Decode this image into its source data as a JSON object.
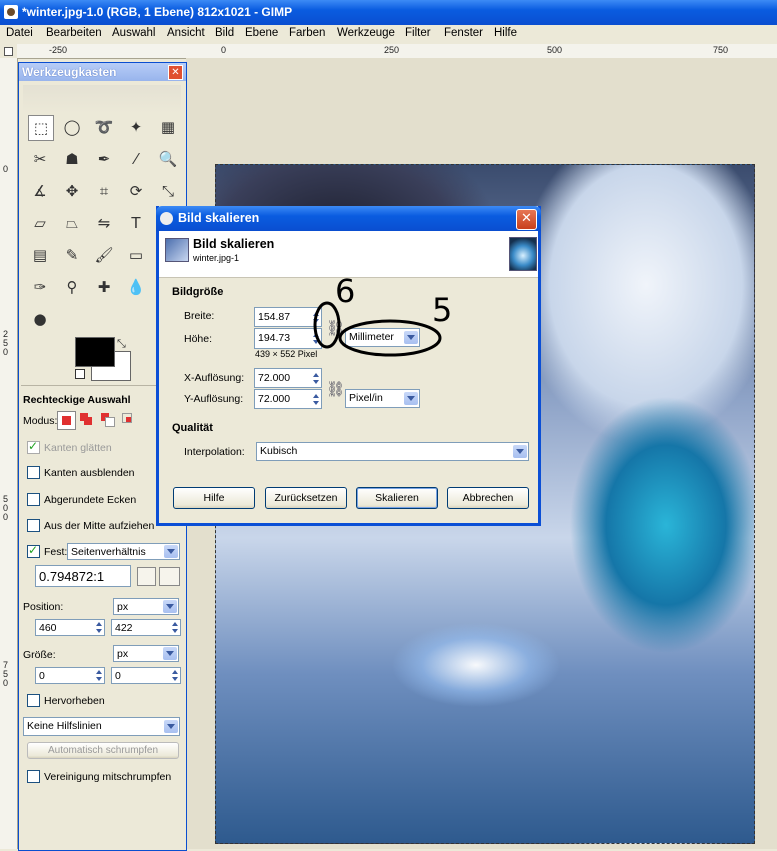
{
  "window": {
    "title": "*winter.jpg-1.0 (RGB, 1 Ebene) 812x1021 - GIMP"
  },
  "menu": [
    "Datei",
    "Bearbeiten",
    "Auswahl",
    "Ansicht",
    "Bild",
    "Ebene",
    "Farben",
    "Werkzeuge",
    "Filter",
    "Fenster",
    "Hilfe"
  ],
  "ruler": {
    "h": [
      "-250",
      "0",
      "250",
      "500",
      "750"
    ],
    "v": [
      "0",
      "2\n5\n0",
      "5\n0\n0",
      "7\n5\n0"
    ]
  },
  "toolbox": {
    "title": "Werkzeugkasten",
    "close": "✕",
    "tools": [
      {
        "name": "rect-select-tool",
        "glyph": "⬚"
      },
      {
        "name": "ellipse-select-tool",
        "glyph": "◯"
      },
      {
        "name": "lasso-tool",
        "glyph": "➰"
      },
      {
        "name": "magic-wand-tool",
        "glyph": "✦"
      },
      {
        "name": "color-select-tool",
        "glyph": "▦"
      },
      {
        "name": "scissors-tool",
        "glyph": "✂"
      },
      {
        "name": "foreground-select-tool",
        "glyph": "☗"
      },
      {
        "name": "paths-tool",
        "glyph": "✒"
      },
      {
        "name": "color-picker-tool",
        "glyph": "⁄"
      },
      {
        "name": "zoom-tool",
        "glyph": "🔍"
      },
      {
        "name": "measure-tool",
        "glyph": "∡"
      },
      {
        "name": "move-tool",
        "glyph": "✥"
      },
      {
        "name": "crop-tool",
        "glyph": "⌗"
      },
      {
        "name": "rotate-tool",
        "glyph": "⟳"
      },
      {
        "name": "scale-tool",
        "glyph": "⤡"
      },
      {
        "name": "shear-tool",
        "glyph": "▱"
      },
      {
        "name": "perspective-tool",
        "glyph": "⏢"
      },
      {
        "name": "flip-tool",
        "glyph": "⇋"
      },
      {
        "name": "text-tool",
        "glyph": "T"
      },
      {
        "name": "bucket-fill-tool",
        "glyph": "◭"
      },
      {
        "name": "blend-tool",
        "glyph": "▤"
      },
      {
        "name": "pencil-tool",
        "glyph": "✎"
      },
      {
        "name": "paintbrush-tool",
        "glyph": "🖌"
      },
      {
        "name": "eraser-tool",
        "glyph": "▭"
      },
      {
        "name": "airbrush-tool",
        "glyph": "⌇"
      },
      {
        "name": "ink-tool",
        "glyph": "✑"
      },
      {
        "name": "clone-tool",
        "glyph": "⚲"
      },
      {
        "name": "heal-tool",
        "glyph": "✚"
      },
      {
        "name": "blur-tool",
        "glyph": "💧"
      },
      {
        "name": "smudge-tool",
        "glyph": "☝"
      },
      {
        "name": "dodge-burn-tool",
        "glyph": "●"
      }
    ],
    "options_title": "Rechteckige Auswahl",
    "modus_label": "Modus:",
    "kanten_glaetten": "Kanten glätten",
    "kanten_ausblenden": "Kanten ausblenden",
    "abgerundete_ecken": "Abgerundete Ecken",
    "aus_der_mitte": "Aus der Mitte aufziehen",
    "fest_label": "Fest:",
    "fest_value": "Seitenverhältnis",
    "ratio": "0.794872:1",
    "position_label": "Position:",
    "position_unit": "px",
    "pos_x": "460",
    "pos_y": "422",
    "groesse_label": "Größe:",
    "groesse_unit": "px",
    "size_w": "0",
    "size_h": "0",
    "hervorheben": "Hervorheben",
    "hilfslinien": "Keine Hilfslinien",
    "auto_shrink": "Automatisch schrumpfen",
    "vereinigung": "Vereinigung mitschrumpfen"
  },
  "dialog": {
    "title": "Bild skalieren",
    "header_title": "Bild skalieren",
    "header_sub": "winter.jpg-1",
    "close": "✕",
    "size_section": "Bildgröße",
    "breite_label": "Breite:",
    "breite_value": "154.87",
    "hoehe_label": "Höhe:",
    "hoehe_value": "194.73",
    "pixel_info": "439 × 552 Pixel",
    "unit": "Millimeter",
    "xres_label": "X-Auflösung:",
    "xres_value": "72.000",
    "yres_label": "Y-Auflösung:",
    "yres_value": "72.000",
    "res_unit": "Pixel/in",
    "quality_section": "Qualität",
    "interp_label": "Interpolation:",
    "interp_value": "Kubisch",
    "buttons": {
      "help": "Hilfe",
      "reset": "Zurücksetzen",
      "scale": "Skalieren",
      "cancel": "Abbrechen"
    }
  },
  "annotations": {
    "six": "6",
    "five": "5"
  }
}
